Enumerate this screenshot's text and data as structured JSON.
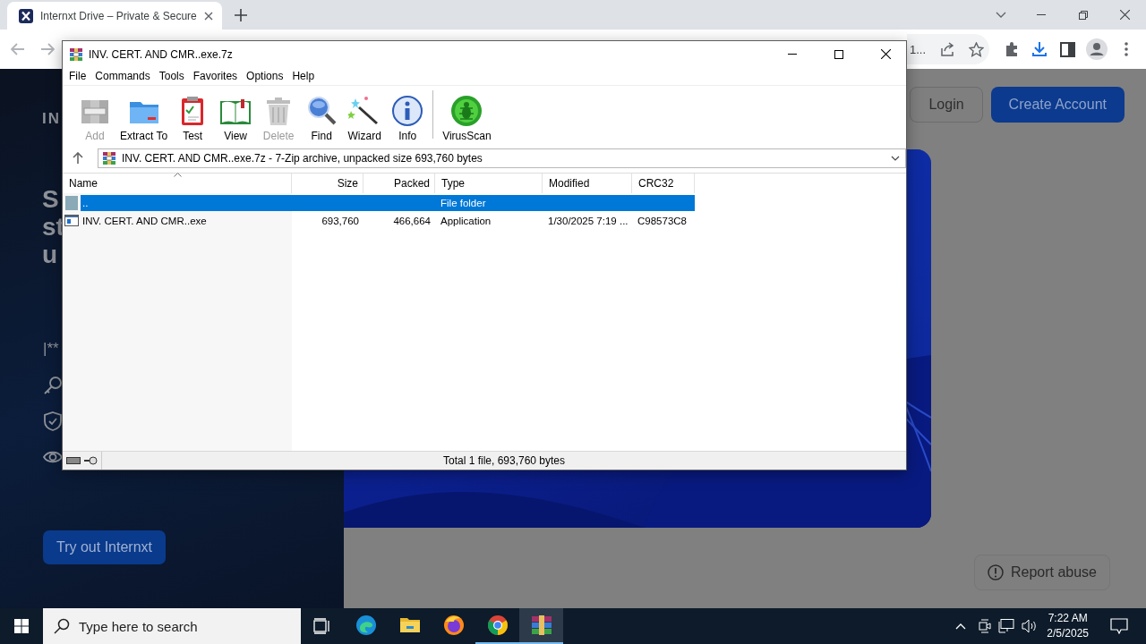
{
  "browser": {
    "tabs": [
      {
        "title": "Internxt Drive – Private & Secure",
        "selected": true
      }
    ],
    "address_text": "1..."
  },
  "page": {
    "brand": "IN",
    "heading_lines": [
      "S",
      "st",
      "u"
    ],
    "feature_text": "|**",
    "nav_buttons": [
      {
        "label": "Login",
        "kind": "outline"
      },
      {
        "label": "Create Account",
        "kind": "primary"
      }
    ],
    "cta_button": "Try out Internxt",
    "report_button": "Report abuse"
  },
  "archive_window": {
    "title": "INV. CERT. AND CMR..exe.7z",
    "menu": [
      "File",
      "Commands",
      "Tools",
      "Favorites",
      "Options",
      "Help"
    ],
    "toolbar": [
      {
        "kind": "add",
        "label": "Add",
        "disabled": true
      },
      {
        "kind": "extract",
        "label": "Extract To",
        "disabled": false
      },
      {
        "kind": "test",
        "label": "Test",
        "disabled": false
      },
      {
        "kind": "view",
        "label": "View",
        "disabled": false
      },
      {
        "kind": "delete",
        "label": "Delete",
        "disabled": true
      },
      {
        "kind": "find",
        "label": "Find",
        "disabled": false
      },
      {
        "kind": "wizard",
        "label": "Wizard",
        "disabled": false
      },
      {
        "kind": "info",
        "label": "Info",
        "disabled": false
      },
      {
        "kind": "virusscan",
        "label": "VirusScan",
        "disabled": false
      }
    ],
    "path": "INV. CERT. AND CMR..exe.7z - 7-Zip archive, unpacked size 693,760 bytes",
    "columns": [
      {
        "label": "Name",
        "sorted": true
      },
      {
        "label": "Size",
        "sorted": false
      },
      {
        "label": "Packed",
        "sorted": false
      },
      {
        "label": "Type",
        "sorted": false
      },
      {
        "label": "Modified",
        "sorted": false
      },
      {
        "label": "CRC32",
        "sorted": false
      }
    ],
    "rows": [
      {
        "kind": "folder",
        "name": "..",
        "type": "File folder",
        "selected": true
      },
      {
        "kind": "file",
        "name": "INV. CERT. AND CMR..exe",
        "size": "693,760",
        "packed": "466,664",
        "type": "Application",
        "modified": "1/30/2025 7:19 ...",
        "crc32": "C98573C8",
        "selected": false
      }
    ],
    "status": "Total 1 file, 693,760 bytes"
  },
  "taskbar": {
    "search_placeholder": "Type here to search",
    "apps": [
      {
        "kind": "edge",
        "running": false,
        "selected": false
      },
      {
        "kind": "explorer",
        "running": false,
        "selected": false
      },
      {
        "kind": "firefox",
        "running": false,
        "selected": false
      },
      {
        "kind": "chrome",
        "running": true,
        "selected": false
      },
      {
        "kind": "winrar",
        "running": true,
        "selected": true
      }
    ],
    "time": "7:22 AM",
    "date": "2/5/2025"
  }
}
